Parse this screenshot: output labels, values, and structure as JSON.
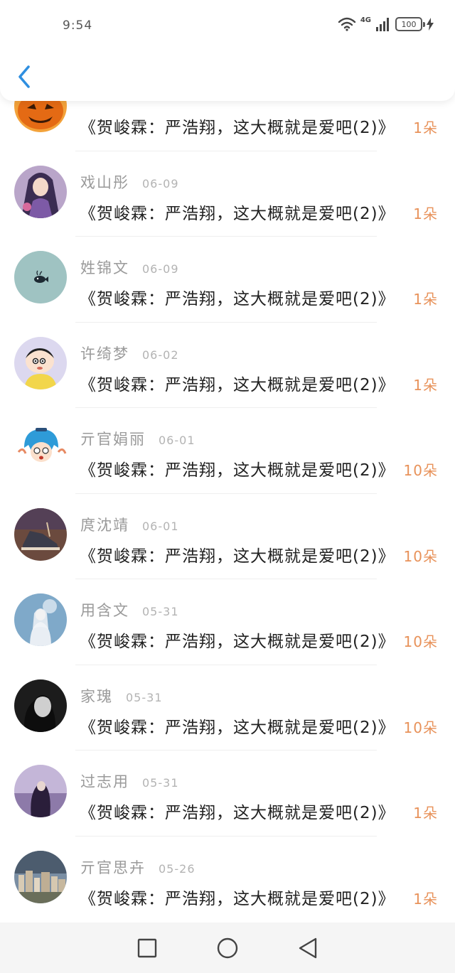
{
  "status_bar": {
    "time": "9:54",
    "network": "4G",
    "battery": "100"
  },
  "nav": {
    "back_icon": "chevron-left-icon"
  },
  "gifts": [
    {
      "name": "",
      "date": "",
      "title": "《贺峻霖：严浩翔，这大概就是爱吧(2)》",
      "count": "1朵",
      "avatar": "pumpkin"
    },
    {
      "name": "戏山彤",
      "date": "06-09",
      "title": "《贺峻霖：严浩翔，这大概就是爱吧(2)》",
      "count": "1朵",
      "avatar": "anime-girl"
    },
    {
      "name": "姓锦文",
      "date": "06-09",
      "title": "《贺峻霖：严浩翔，这大概就是爱吧(2)》",
      "count": "1朵",
      "avatar": "whale"
    },
    {
      "name": "许绮梦",
      "date": "06-02",
      "title": "《贺峻霖：严浩翔，这大概就是爱吧(2)》",
      "count": "1朵",
      "avatar": "cartoon-boy"
    },
    {
      "name": "亓官娟丽",
      "date": "06-01",
      "title": "《贺峻霖：严浩翔，这大概就是爱吧(2)》",
      "count": "10朵",
      "avatar": "blue-hair-chibi"
    },
    {
      "name": "庹沈靖",
      "date": "06-01",
      "title": "《贺峻霖：严浩翔，这大概就是爱吧(2)》",
      "count": "10朵",
      "avatar": "sneaker"
    },
    {
      "name": "用含文",
      "date": "05-31",
      "title": "《贺峻霖：严浩翔，这大概就是爱吧(2)》",
      "count": "10朵",
      "avatar": "angel-girl"
    },
    {
      "name": "家瑰",
      "date": "05-31",
      "title": "《贺峻霖：严浩翔，这大概就是爱吧(2)》",
      "count": "10朵",
      "avatar": "bw-portrait"
    },
    {
      "name": "过志用",
      "date": "05-31",
      "title": "《贺峻霖：严浩翔，这大概就是爱吧(2)》",
      "count": "1朵",
      "avatar": "purple-girl"
    },
    {
      "name": "亓官思卉",
      "date": "05-26",
      "title": "《贺峻霖：严浩翔，这大概就是爱吧(2)》",
      "count": "1朵",
      "avatar": "city-skyline"
    }
  ],
  "bottom_nav": [
    "recent-apps-icon",
    "home-icon",
    "back-triangle-icon"
  ]
}
